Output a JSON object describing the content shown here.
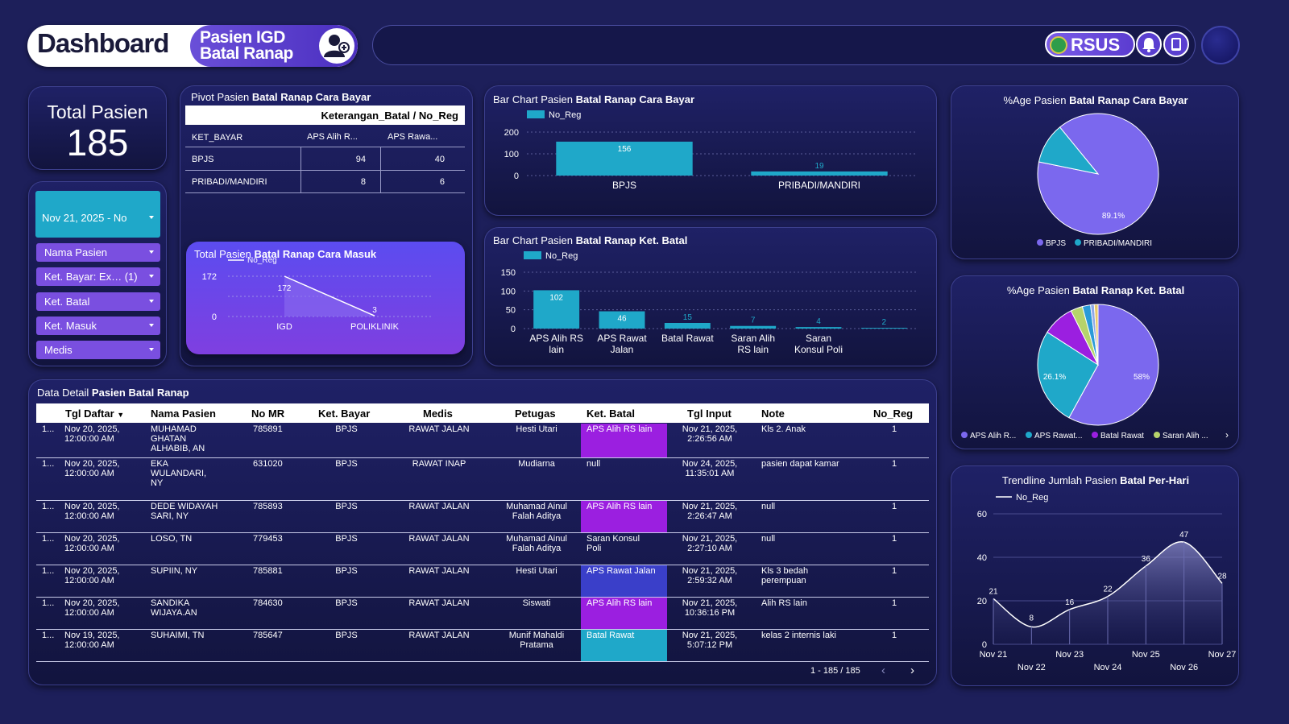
{
  "header": {
    "dashboard_label": "Dashboard",
    "subtitle_line1": "Pasien IGD",
    "subtitle_line2": "Batal Ranap",
    "brand": "RSUS"
  },
  "total": {
    "label": "Total Pasien",
    "value": "185"
  },
  "filters": {
    "date": "Nov 21, 2025 - No",
    "items": [
      "Nama Pasien",
      "Ket. Bayar: Ex… (1)",
      "Ket. Batal",
      "Ket. Masuk",
      "Medis"
    ]
  },
  "pivot": {
    "title_prefix": "Pivot Pasien ",
    "title_bold": "Batal Ranap Cara Bayar",
    "group_header": "Keterangan_Batal / No_Reg",
    "row_header": "KET_BAYAR",
    "col1": "APS Alih R...",
    "col2": "APS Rawa...",
    "rows": [
      {
        "label": "BPJS",
        "v1": "94",
        "v2": "40"
      },
      {
        "label": "PRIBADI/MANDIRI",
        "v1": "8",
        "v2": "6"
      }
    ]
  },
  "titles": {
    "masuk_prefix": "Total Pasien ",
    "masuk_bold": "Batal Ranap Cara Masuk",
    "bar_bayar_prefix": "Bar Chart Pasien ",
    "bar_bayar_bold": "Batal Ranap Cara Bayar",
    "bar_batal_prefix": "Bar Chart Pasien ",
    "bar_batal_bold": "Batal Ranap Ket. Batal",
    "pie_bayar_prefix": "%Age Pasien ",
    "pie_bayar_bold": "Batal Ranap Cara Bayar",
    "pie_batal_prefix": "%Age Pasien ",
    "pie_batal_bold": "Batal Ranap Ket. Batal",
    "trend_prefix": "Trendline Jumlah Pasien ",
    "trend_bold": "Batal Per-Hari",
    "detail_prefix": "Data Detail ",
    "detail_bold": "Pasien Batal Ranap"
  },
  "colors": {
    "bar": "#1fa8c9",
    "purple": "#7b68ee",
    "aps_alih": "#9b1fe0",
    "aps_rawat": "#3a3fc9",
    "batal_rawat": "#1fa8c9"
  },
  "chart_data": [
    {
      "id": "masuk",
      "type": "area",
      "legend": [
        "No_Reg"
      ],
      "categories": [
        "IGD",
        "POLIKLINIK"
      ],
      "values": [
        172,
        3
      ],
      "yticks": [
        "172",
        "0"
      ]
    },
    {
      "id": "bar_bayar",
      "type": "bar",
      "legend": [
        "No_Reg"
      ],
      "categories": [
        "BPJS",
        "PRIBADI/MANDIRI"
      ],
      "values": [
        156,
        19
      ],
      "ylim": [
        0,
        200
      ],
      "yticks": [
        "200",
        "100",
        "0"
      ]
    },
    {
      "id": "bar_batal",
      "type": "bar",
      "legend": [
        "No_Reg"
      ],
      "categories": [
        "APS Alih RS lain",
        "APS Rawat Jalan",
        "Batal Rawat",
        "Saran Alih RS lain",
        "Saran Konsul Poli",
        ""
      ],
      "category_lines": [
        [
          "APS Alih RS",
          "lain"
        ],
        [
          "APS Rawat",
          "Jalan"
        ],
        [
          "Batal Rawat"
        ],
        [
          "Saran Alih",
          "RS lain"
        ],
        [
          "Saran",
          "Konsul Poli"
        ],
        []
      ],
      "values": [
        102,
        46,
        15,
        7,
        4,
        2
      ],
      "ylim": [
        0,
        150
      ],
      "yticks": [
        "150",
        "100",
        "50",
        "0"
      ]
    },
    {
      "id": "pie_bayar",
      "type": "pie",
      "labels": [
        "BPJS",
        "PRIBADI/MANDIRI"
      ],
      "values": [
        89.1,
        10.9
      ],
      "shown_label": "89.1%",
      "colors": [
        "#7b68ee",
        "#1fa8c9"
      ]
    },
    {
      "id": "pie_batal",
      "type": "pie",
      "labels": [
        "APS Alih R...",
        "APS Rawat...",
        "Batal Rawat",
        "Saran Alih ..."
      ],
      "values": [
        58,
        26.1,
        8.5,
        3.2,
        2.2,
        1.0,
        1.0
      ],
      "shown_labels": [
        "58%",
        "26.1%"
      ],
      "colors": [
        "#7b68ee",
        "#1fa8c9",
        "#9b1fe0",
        "#b6d36b",
        "#2a9bd8",
        "#8fa8e8",
        "#e8c86a"
      ]
    },
    {
      "id": "trend",
      "type": "line",
      "legend": [
        "No_Reg"
      ],
      "x": [
        "Nov 21",
        "Nov 22",
        "Nov 23",
        "Nov 24",
        "Nov 25",
        "Nov 26",
        "Nov 27"
      ],
      "values": [
        21,
        8,
        16,
        22,
        36,
        47,
        28
      ],
      "ylim": [
        0,
        60
      ],
      "yticks": [
        "60",
        "40",
        "20",
        "0"
      ]
    }
  ],
  "table": {
    "columns": [
      "Tgl Daftar",
      "Nama Pasien",
      "No MR",
      "Ket. Bayar",
      "Medis",
      "Petugas",
      "Ket. Batal",
      "Tgl Input",
      "Note",
      "No_Reg"
    ],
    "rows": [
      {
        "idx": "1...",
        "tgl": [
          "Nov 20, 2025,",
          "12:00:00 AM"
        ],
        "nama": [
          "MUHAMAD",
          "GHATAN",
          "ALHABIB, AN"
        ],
        "mr": "785891",
        "bayar": "BPJS",
        "medis": "RAWAT JALAN",
        "petugas": [
          "Hesti Utari"
        ],
        "batal": [
          "APS Alih RS lain"
        ],
        "batal_color": "#9b1fe0",
        "input": [
          "Nov 21, 2025,",
          "2:26:56 AM"
        ],
        "note": [
          "Kls 2. Anak"
        ],
        "reg": "1"
      },
      {
        "idx": "1...",
        "tgl": [
          "Nov 20, 2025,",
          "12:00:00 AM"
        ],
        "nama": [
          "EKA",
          "WULANDARI,",
          "NY"
        ],
        "mr": "631020",
        "bayar": "BPJS",
        "medis": "RAWAT INAP",
        "petugas": [
          "Mudiarna"
        ],
        "batal": [
          "null"
        ],
        "batal_color": "",
        "input": [
          "Nov 24, 2025,",
          "11:35:01 AM"
        ],
        "note": [
          "pasien dapat kamar"
        ],
        "reg": "1"
      },
      {
        "idx": "1...",
        "tgl": [
          "Nov 20, 2025,",
          "12:00:00 AM"
        ],
        "nama": [
          "DEDE WIDAYAH",
          "SARI, NY"
        ],
        "mr": "785893",
        "bayar": "BPJS",
        "medis": "RAWAT JALAN",
        "petugas": [
          "Muhamad Ainul",
          "Falah Aditya"
        ],
        "batal": [
          "APS Alih RS lain"
        ],
        "batal_color": "#9b1fe0",
        "input": [
          "Nov 21, 2025,",
          "2:26:47 AM"
        ],
        "note": [
          "null"
        ],
        "reg": "1"
      },
      {
        "idx": "1...",
        "tgl": [
          "Nov 20, 2025,",
          "12:00:00 AM"
        ],
        "nama": [
          "LOSO, TN"
        ],
        "mr": "779453",
        "bayar": "BPJS",
        "medis": "RAWAT JALAN",
        "petugas": [
          "Muhamad Ainul",
          "Falah Aditya"
        ],
        "batal": [
          "Saran Konsul",
          "Poli"
        ],
        "batal_color": "",
        "input": [
          "Nov 21, 2025,",
          "2:27:10 AM"
        ],
        "note": [
          "null"
        ],
        "reg": "1"
      },
      {
        "idx": "1...",
        "tgl": [
          "Nov 20, 2025,",
          "12:00:00 AM"
        ],
        "nama": [
          "SUPIIN, NY"
        ],
        "mr": "785881",
        "bayar": "BPJS",
        "medis": "RAWAT JALAN",
        "petugas": [
          "Hesti Utari"
        ],
        "batal": [
          "APS Rawat Jalan"
        ],
        "batal_color": "#3a3fc9",
        "input": [
          "Nov 21, 2025,",
          "2:59:32 AM"
        ],
        "note": [
          "Kls 3 bedah",
          "perempuan"
        ],
        "reg": "1"
      },
      {
        "idx": "1...",
        "tgl": [
          "Nov 20, 2025,",
          "12:00:00 AM"
        ],
        "nama": [
          "SANDIKA",
          "WIJAYA.AN"
        ],
        "mr": "784630",
        "bayar": "BPJS",
        "medis": "RAWAT JALAN",
        "petugas": [
          "Siswati"
        ],
        "batal": [
          "APS Alih RS lain"
        ],
        "batal_color": "#9b1fe0",
        "input": [
          "Nov 21, 2025,",
          "10:36:16 PM"
        ],
        "note": [
          "Alih RS lain"
        ],
        "reg": "1"
      },
      {
        "idx": "1...",
        "tgl": [
          "Nov 19, 2025,",
          "12:00:00 AM"
        ],
        "nama": [
          "SUHAIMI, TN"
        ],
        "mr": "785647",
        "bayar": "BPJS",
        "medis": "RAWAT JALAN",
        "petugas": [
          "Munif Mahaldi",
          "Pratama"
        ],
        "batal": [
          "Batal Rawat"
        ],
        "batal_color": "#1fa8c9",
        "input": [
          "Nov 21, 2025,",
          "5:07:12 PM"
        ],
        "note": [
          "kelas 2 internis laki"
        ],
        "reg": "1"
      }
    ],
    "pagination": "1 - 185 / 185"
  }
}
